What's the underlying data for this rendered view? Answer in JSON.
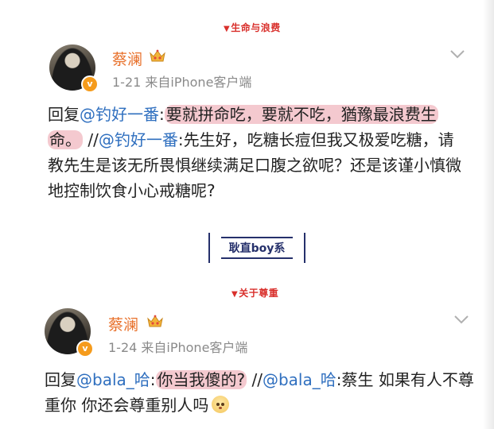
{
  "sections": [
    {
      "label": "生命与浪费"
    },
    {
      "label": "关于尊重"
    }
  ],
  "divider_tag": "耿直boy系",
  "posts": [
    {
      "username": "蔡澜",
      "meta": "1-21  来自iPhone客户端",
      "verified": "v",
      "text": {
        "reply_prefix": "回复",
        "mention1": "@钓好一番",
        "colon1": ":",
        "highlight": "要就拼命吃，要就不吃，猶豫最浪费生命。",
        "sep": " //",
        "mention2": "@钓好一番",
        "rest": ":先生好，吃糖长痘但我又极爱吃糖，请教先生是该无所畏惧继续满足口腹之欲呢？还是该谨小慎微地控制饮食小心戒糖呢?"
      }
    },
    {
      "username": "蔡澜",
      "meta": "1-24  来自iPhone客户端",
      "verified": "v",
      "text": {
        "reply_prefix": "回复",
        "mention1": "@bala_哈",
        "colon1": ":",
        "highlight": "你当我傻的?",
        "sep": " //",
        "mention2": "@bala_哈",
        "rest": ":蔡生 如果有人不尊重你 你还会尊重别人吗"
      }
    }
  ],
  "colors": {
    "section_label": "#d9302c",
    "username": "#e8702a",
    "mention": "#2f6fbf",
    "highlight": "#f4c9cf",
    "tag": "#25306b"
  }
}
